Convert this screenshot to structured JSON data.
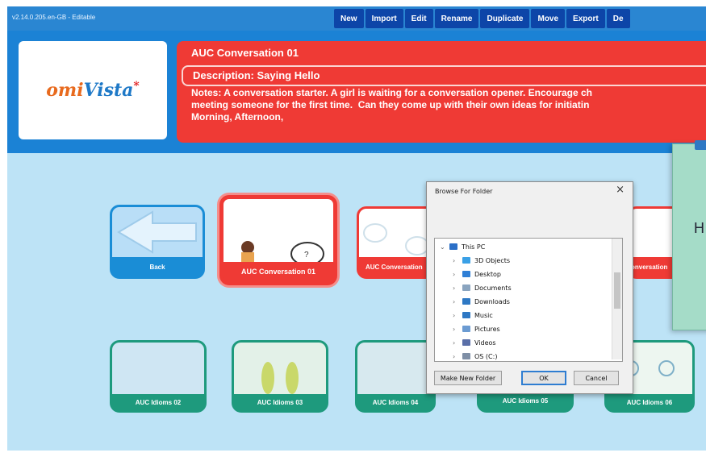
{
  "app": {
    "version": "v2.14.0.205.en-GB - Editable",
    "toolbar": [
      "New",
      "Import",
      "Edit",
      "Rename",
      "Duplicate",
      "Move",
      "Export",
      "De"
    ]
  },
  "header": {
    "logo": "omiVista",
    "title": "AUC Conversation 01",
    "description": "Description: Saying Hello",
    "notes": "Notes: A conversation starter. A girl is waiting for a conversation opener. Encourage ch\nmeeting someone for the first time.  Can they come up with their own ideas for initiatin\nMorning, Afternoon,"
  },
  "tiles_row1": [
    {
      "label": "Back"
    },
    {
      "label": "AUC Conversation 01"
    },
    {
      "label": "AUC Conversation"
    },
    {
      "label": "onversation"
    }
  ],
  "tiles_row2": [
    {
      "label": "AUC Idioms 02"
    },
    {
      "label": "AUC Idioms 03"
    },
    {
      "label": "AUC Idioms 04"
    },
    {
      "label": "AUC Idioms 05"
    },
    {
      "label": "AUC Idioms 06"
    }
  ],
  "dialog": {
    "title": "Browse For Folder",
    "close": "×",
    "tree": [
      {
        "label": "This PC",
        "icon": "pc-icon",
        "color": "#2b6fc7"
      },
      {
        "label": "3D Objects",
        "icon": "3d-objects-icon",
        "color": "#3aa0e6"
      },
      {
        "label": "Desktop",
        "icon": "desktop-icon",
        "color": "#2f7fd6"
      },
      {
        "label": "Documents",
        "icon": "documents-icon",
        "color": "#8aa4bf"
      },
      {
        "label": "Downloads",
        "icon": "downloads-icon",
        "color": "#2e78c4"
      },
      {
        "label": "Music",
        "icon": "music-icon",
        "color": "#2e78c4"
      },
      {
        "label": "Pictures",
        "icon": "pictures-icon",
        "color": "#6b9bd2"
      },
      {
        "label": "Videos",
        "icon": "videos-icon",
        "color": "#5a6fa8"
      },
      {
        "label": "OS (C:)",
        "icon": "drive-icon",
        "color": "#7f8fa6"
      }
    ],
    "buttons": {
      "new_folder": "Make New Folder",
      "ok": "OK",
      "cancel": "Cancel"
    }
  },
  "side_card": {
    "letter": "H"
  }
}
